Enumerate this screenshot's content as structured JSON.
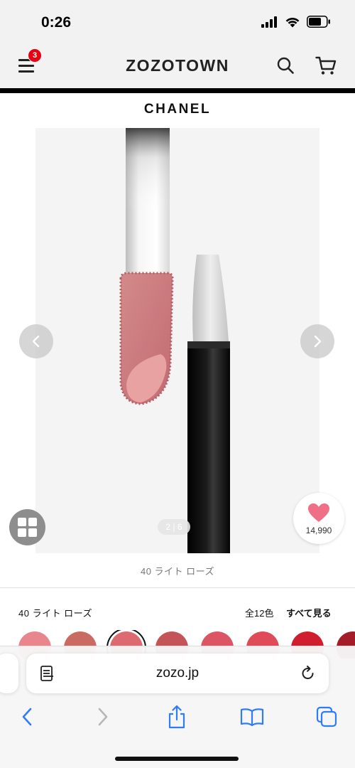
{
  "status_bar": {
    "time": "0:26"
  },
  "header": {
    "logo": "ZOZOTOWN",
    "menu_badge": "3"
  },
  "product": {
    "brand": "CHANEL",
    "image_page": "2 | 6",
    "favorite_count": "14,990",
    "color_caption": "40 ライト ローズ"
  },
  "colors": {
    "selected_label": "40 ライト ローズ",
    "count": "全12色",
    "see_all": "すべて見る",
    "swatches": [
      "#e8858d",
      "#c96a63",
      "#dd6a70",
      "#c55458",
      "#db5564",
      "#e04b5a",
      "#cf1f2f",
      "#a41c2a"
    ]
  },
  "browser": {
    "url": "zozo.jp"
  },
  "theme": {
    "accent": "#2f7cf6",
    "badge": "#e60012",
    "heart": "#ee6f86"
  },
  "icons": [
    "menu-icon",
    "search-icon",
    "cart-icon",
    "chevron-left-icon",
    "chevron-right-icon",
    "grid-icon",
    "heart-icon",
    "reader-icon",
    "reload-icon",
    "back-icon",
    "forward-icon",
    "share-icon",
    "bookmarks-icon",
    "tabs-icon"
  ]
}
